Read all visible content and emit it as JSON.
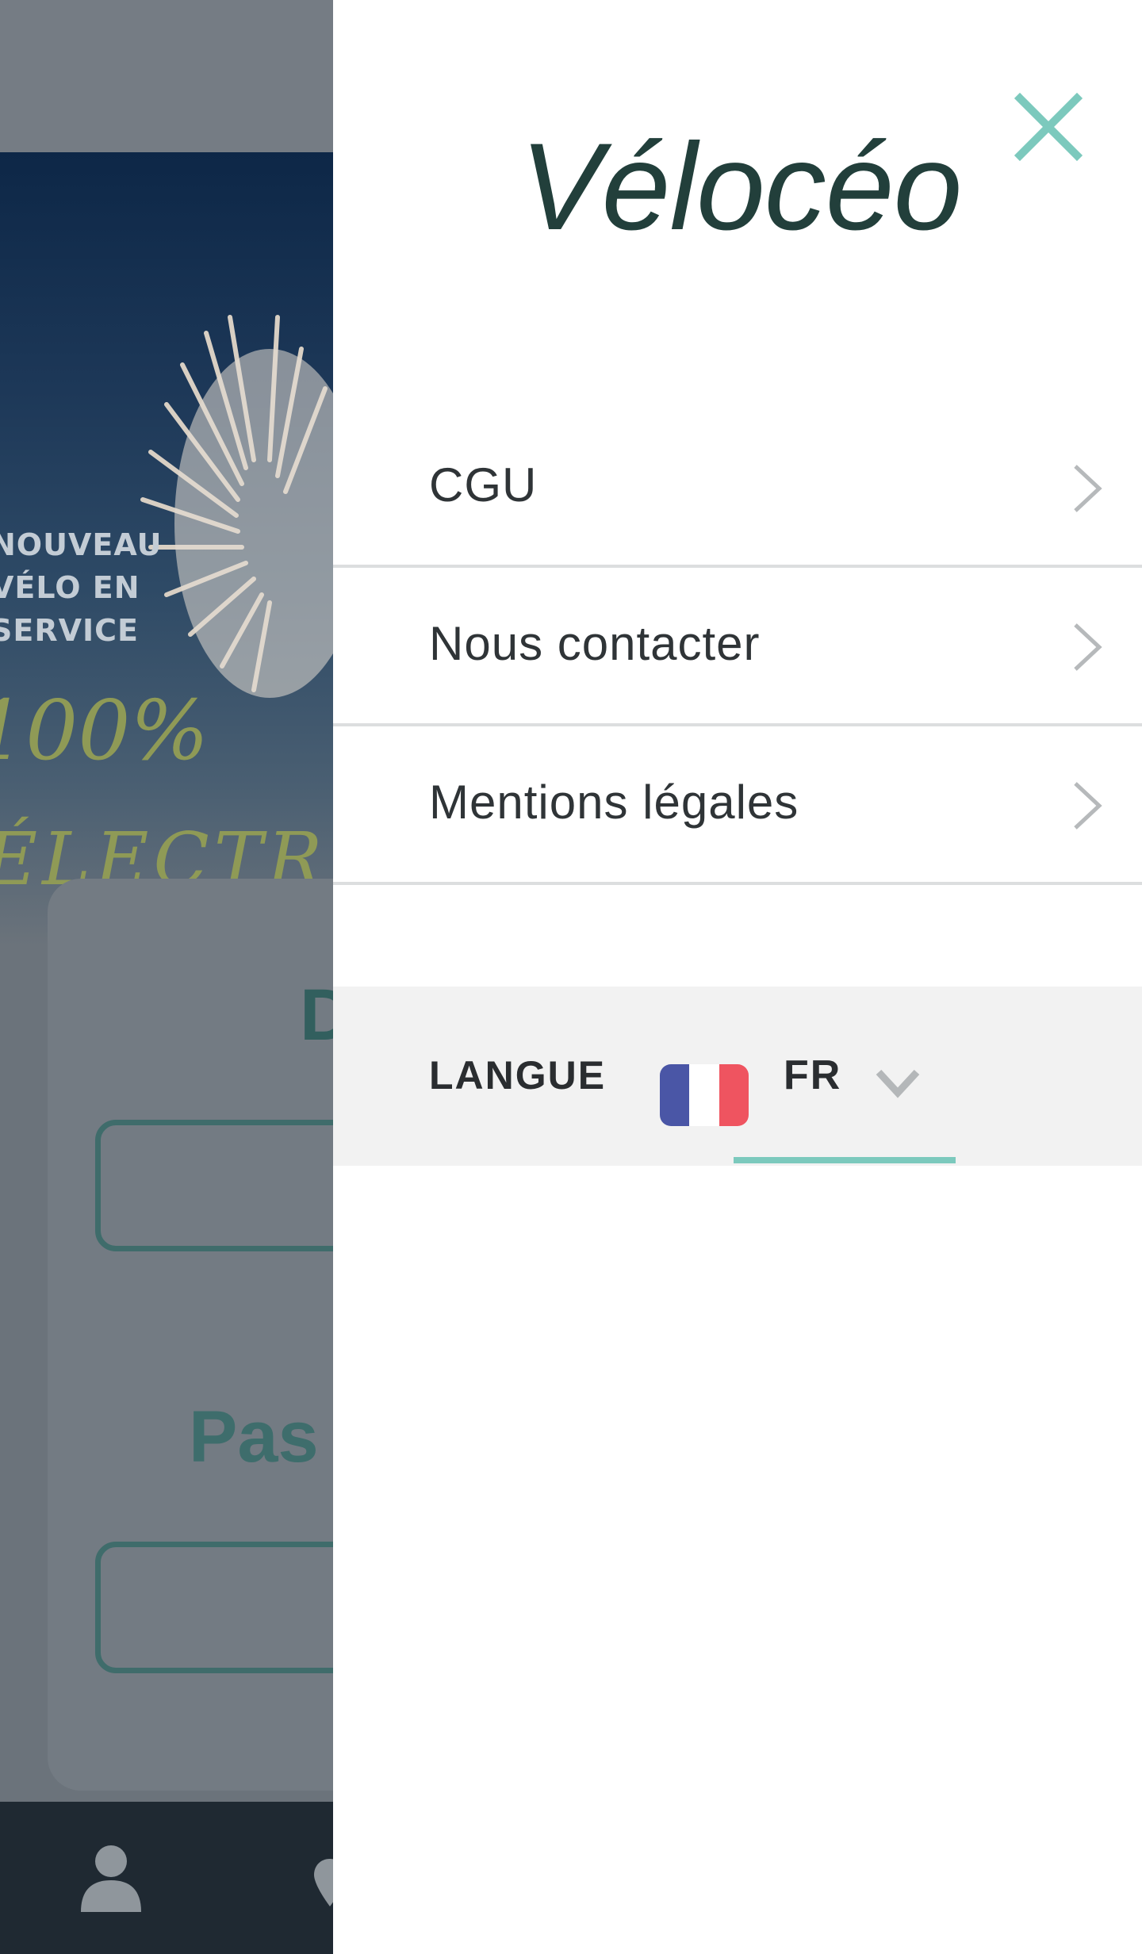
{
  "background": {
    "hero_lines": [
      "NOUVEAU",
      "VÉLO EN",
      "SERVICE"
    ],
    "hero_percent": "100%",
    "hero_electric": "ÉLECTRIQUE",
    "card_title_fragment": "D",
    "signup_prompt_fragment": "Pas",
    "tabbar_icons": [
      "user-icon",
      "map-pin-icon"
    ]
  },
  "drawer": {
    "logo": "Vélocéo",
    "close_icon": "close-icon",
    "menu": [
      {
        "label": "CGU"
      },
      {
        "label": "Nous contacter"
      },
      {
        "label": "Mentions légales"
      }
    ],
    "language": {
      "label": "LANGUE",
      "selected": "FR",
      "flag": "france-flag-icon"
    }
  },
  "colors": {
    "accent": "#7cc9bd",
    "logo_text": "#223f3b",
    "flag_blue": "#4a56a6",
    "flag_white": "#ffffff",
    "flag_red": "#ef5460"
  }
}
